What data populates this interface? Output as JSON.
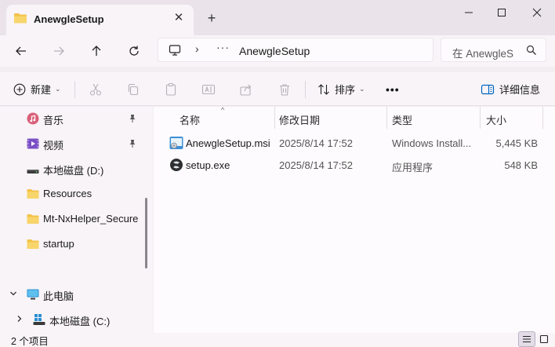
{
  "tab": {
    "title": "AnewgleSetup",
    "close": "✕"
  },
  "new_tab": "+",
  "address": {
    "path_dots": "···",
    "current": "AnewgleSetup"
  },
  "search": {
    "placeholder": "在 AnewgleSetup 中搜索"
  },
  "toolbar": {
    "new_label": "新建",
    "sort_label": "排序",
    "more": "•••",
    "details_label": "详细信息"
  },
  "nav": {
    "items": [
      {
        "label": "音乐",
        "icon": "music-icon",
        "pinned": true
      },
      {
        "label": "视频",
        "icon": "video-icon",
        "pinned": true
      },
      {
        "label": "本地磁盘 (D:)",
        "icon": "drive-icon",
        "pinned": false
      },
      {
        "label": "Resources",
        "icon": "folder-icon",
        "pinned": false
      },
      {
        "label": "Mt-NxHelper_Secure",
        "icon": "folder-icon",
        "pinned": false
      },
      {
        "label": "startup",
        "icon": "folder-icon",
        "pinned": false
      }
    ],
    "this_pc": "此电脑",
    "local_c": "本地磁盘 (C:)"
  },
  "columns": {
    "name": "名称",
    "modified": "修改日期",
    "type": "类型",
    "size": "大小"
  },
  "files": [
    {
      "name": "AnewgleSetup.msi",
      "modified": "2025/8/14 17:52",
      "type": "Windows Install...",
      "size": "5,445 KB",
      "icon": "msi-installer-icon"
    },
    {
      "name": "setup.exe",
      "modified": "2025/8/14 17:52",
      "type": "应用程序",
      "size": "548 KB",
      "icon": "exe-app-icon"
    }
  ],
  "status": {
    "count": "2 个项目"
  },
  "colors": {
    "folder": "#f3c24a",
    "accent": "#0067c0",
    "bg": "#f8f4f8",
    "content_bg": "#fdfbfd"
  }
}
